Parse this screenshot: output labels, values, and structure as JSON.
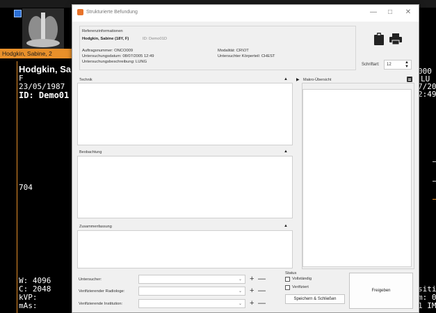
{
  "viewer": {
    "tab_label": "Hodgkin, Sabine, 2",
    "patient_name": "Hodgkin, Sa",
    "sex": "F",
    "dob": "23/05/1987",
    "id_label": "ID: Demo01",
    "left_mid_value": "704",
    "window_width": "W: 4096",
    "window_center": "C: 2048",
    "kvp": "kVP:",
    "mas": "mAs:",
    "right_line1": "000",
    "right_line2": "LU",
    "right_line3": "7/20",
    "right_line4": "2:49",
    "right_bottom1": "sitivit",
    "right_bottom2": "m: 0.",
    "right_bottom3": "1 IMA",
    "accent_color": "#e8902a"
  },
  "dialog": {
    "title": "Strukturierte Befundung",
    "minimize": "—",
    "maximize": "□",
    "close": "✕",
    "ref": {
      "heading": "Referenzinformationen",
      "patient_line": "Hodgkin, Sabine (18Y, F)",
      "patient_id": "ID: Demo01D",
      "order_number": "Auftragsnummer: ONCO009",
      "exam_date": "Untersuchungsdatum: 08/07/2005 12:49",
      "exam_desc": "Untersuchungsbeschreibung: LUNG",
      "modality": "Modalität: CR\\OT",
      "body_part": "Untersuchter Körperteil: CHEST"
    },
    "toolbar": {
      "clipboard_icon": "clipboard-icon",
      "print_icon": "printer-icon",
      "font_label": "Schriftart:",
      "font_value": "12"
    },
    "sections": {
      "technik": "Technik",
      "beobachtung": "Beobachtung",
      "zusammenfassung": "Zusammenfassung",
      "makro": "Makro-Übersicht"
    },
    "form": {
      "examiner_label": "Untersucher:",
      "radiologist_label": "Verifizierender Radiologe:",
      "institution_label": "Verifizierende Institution:",
      "plus": "+",
      "minus": "—",
      "chevron": "⌄"
    },
    "status": {
      "heading": "Status",
      "complete": "Vollständig",
      "verified": "Verifiziert",
      "save_close": "Speichern & Schließen",
      "release": "Freigeben"
    }
  }
}
